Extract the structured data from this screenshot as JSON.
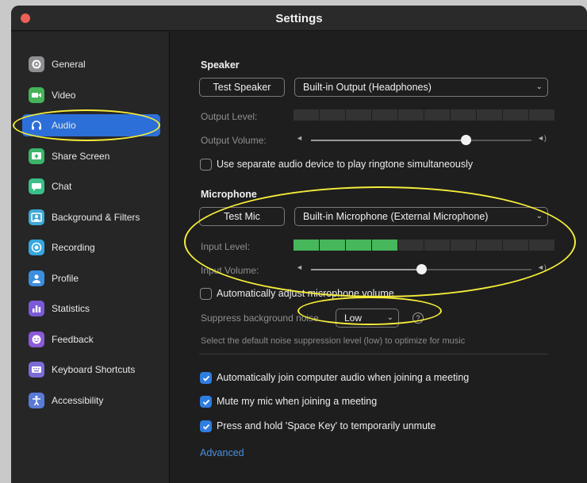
{
  "window": {
    "title": "Settings"
  },
  "colors": {
    "accent": "#2d6fd8",
    "meter_on": "#46b75a",
    "highlight": "#f5ed3a",
    "link": "#4a8fe0"
  },
  "sidebar": {
    "items": [
      {
        "label": "General",
        "icon": "gear-icon",
        "color": "#8e8e93"
      },
      {
        "label": "Video",
        "icon": "video-icon",
        "color": "#45b35a"
      },
      {
        "label": "Audio",
        "icon": "headphones-icon",
        "color": "#2d6fd8",
        "active": true
      },
      {
        "label": "Share Screen",
        "icon": "share-screen-icon",
        "color": "#3bb56a"
      },
      {
        "label": "Chat",
        "icon": "chat-icon",
        "color": "#3bbf8a"
      },
      {
        "label": "Background & Filters",
        "icon": "background-icon",
        "color": "#3fa7d6"
      },
      {
        "label": "Recording",
        "icon": "recording-icon",
        "color": "#35a7e0"
      },
      {
        "label": "Profile",
        "icon": "profile-icon",
        "color": "#3b8ee0"
      },
      {
        "label": "Statistics",
        "icon": "statistics-icon",
        "color": "#7a5ad8"
      },
      {
        "label": "Feedback",
        "icon": "feedback-icon",
        "color": "#8a5ad8"
      },
      {
        "label": "Keyboard Shortcuts",
        "icon": "keyboard-icon",
        "color": "#7a6cd8"
      },
      {
        "label": "Accessibility",
        "icon": "accessibility-icon",
        "color": "#5a7ad8"
      }
    ]
  },
  "speaker": {
    "heading": "Speaker",
    "test_button": "Test Speaker",
    "device": "Built-in Output (Headphones)",
    "output_level_label": "Output Level:",
    "output_level_segments_on": 0,
    "output_volume_label": "Output Volume:",
    "output_volume": 0.7,
    "separate_device_label": "Use separate audio device to play ringtone simultaneously",
    "separate_device_checked": false
  },
  "microphone": {
    "heading": "Microphone",
    "test_button": "Test Mic",
    "device": "Built-in Microphone (External Microphone)",
    "input_level_label": "Input Level:",
    "input_level_segments_on": 4,
    "input_volume_label": "Input Volume:",
    "input_volume": 0.5,
    "auto_adjust_label": "Automatically adjust microphone volume",
    "auto_adjust_checked": false,
    "suppress_label": "Suppress background noise",
    "suppress_value": "Low",
    "help_glyph": "?",
    "suppress_hint": "Select the default noise suppression level (low) to optimize for music"
  },
  "options": [
    {
      "label": "Automatically join computer audio when joining a meeting",
      "checked": true
    },
    {
      "label": "Mute my mic when joining a meeting",
      "checked": true
    },
    {
      "label": "Press and hold 'Space Key' to temporarily unmute",
      "checked": true
    }
  ],
  "advanced_link": "Advanced"
}
